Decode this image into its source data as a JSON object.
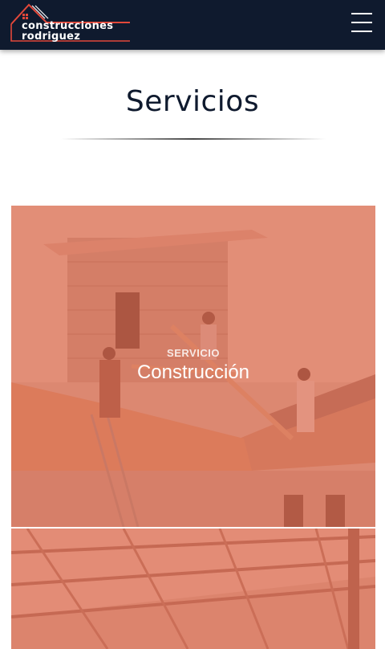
{
  "header": {
    "logo_line1": "construcciones",
    "logo_line2": "rodriguez",
    "menu_icon": "hamburger-menu-icon"
  },
  "page": {
    "title": "Servicios"
  },
  "services": [
    {
      "kicker": "SERVICIO",
      "title": "Construcción"
    }
  ],
  "colors": {
    "navbar": "#0f1a2e",
    "overlay": "#e86e52",
    "logo_accent": "#e2483a"
  }
}
